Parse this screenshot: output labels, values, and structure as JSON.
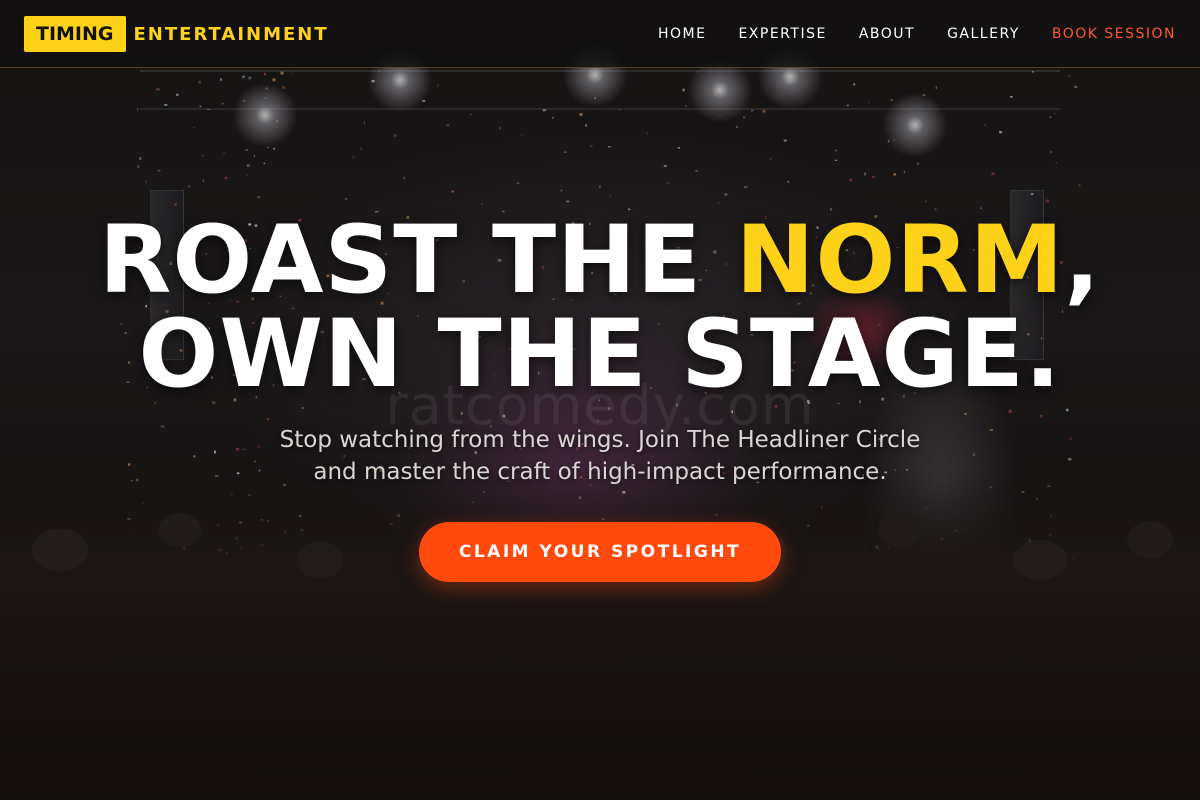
{
  "brand": {
    "box_text": "TIMING",
    "text": "ENTERTAINMENT"
  },
  "nav": {
    "items": [
      {
        "label": "HOME"
      },
      {
        "label": "EXPERTISE"
      },
      {
        "label": "ABOUT"
      },
      {
        "label": "GALLERY"
      },
      {
        "label": "BOOK SESSION"
      }
    ]
  },
  "hero": {
    "headline_part1": "ROAST THE ",
    "headline_accent": "NORM",
    "headline_part2": ",",
    "headline_line2": "OWN THE STAGE.",
    "subtitle_line1": "Stop watching from the wings. Join The Headliner Circle",
    "subtitle_line2": "and master the craft of high-impact performance.",
    "cta_label": "CLAIM YOUR SPOTLIGHT",
    "watermark": "ratcomedy.com"
  },
  "colors": {
    "accent_yellow": "#ffd21a",
    "cta_orange": "#ff4a0e",
    "nav_cta": "#ff5a2a",
    "background": "#0d0b0b"
  }
}
